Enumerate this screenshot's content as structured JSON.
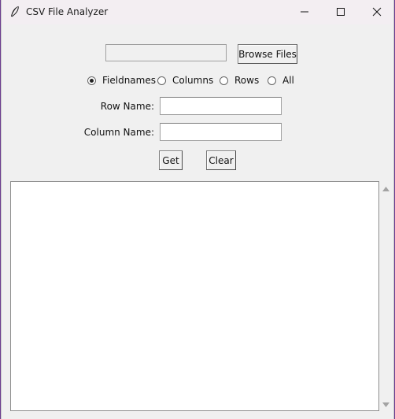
{
  "window": {
    "title": "CSV File Analyzer"
  },
  "titlebar_icons": {
    "app": "feather-icon",
    "minimize": "minimize-icon",
    "maximize": "maximize-icon",
    "close": "close-icon"
  },
  "file": {
    "path_value": "",
    "browse_label": "Browse Files"
  },
  "mode": {
    "options": [
      "Fieldnames",
      "Columns",
      "Rows",
      "All"
    ],
    "selected": "Fieldnames"
  },
  "form": {
    "row_label": "Row Name:",
    "row_value": "",
    "column_label": "Column Name:",
    "column_value": ""
  },
  "actions": {
    "get_label": "Get",
    "clear_label": "Clear"
  },
  "output": {
    "text": ""
  },
  "colors": {
    "window_bg": "#f0f0f0",
    "titlebar_bg": "#f3eef2",
    "output_bg": "#ffffff"
  }
}
